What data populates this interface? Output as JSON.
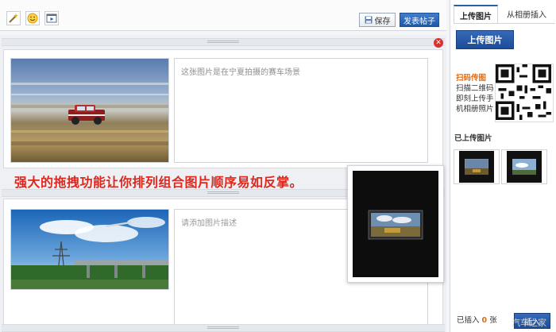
{
  "toolbar": {
    "icons": [
      "magic-wand-icon",
      "emoji-icon",
      "video-icon"
    ],
    "save_label": "保存",
    "publish_label": "发表帖子"
  },
  "editor": {
    "items": [
      {
        "photo": "rally-car-photo",
        "description": "这张图片是在宁夏拍摄的赛车场景",
        "has_value": true
      },
      {
        "photo": "power-tower-bridge-photo",
        "description": "请添加图片描述",
        "has_value": false
      }
    ],
    "callout": "强大的拖拽功能让你排列组合图片顺序易如反掌。"
  },
  "sidebar": {
    "tabs": [
      "上传图片",
      "从相册插入"
    ],
    "upload_button": "上传图片",
    "qr": {
      "title": "扫码传图",
      "lines": [
        "扫描二维码",
        "即刻上传手",
        "机相册照片"
      ]
    },
    "uploaded_title": "已上传图片",
    "inserted_prefix": "已插入",
    "inserted_count": "0",
    "inserted_unit": "张",
    "insert_button": "插入"
  },
  "watermark": "汽车之家",
  "colors": {
    "accent": "#1e5aa8",
    "callout": "#e2261b",
    "close": "#d9312b"
  }
}
